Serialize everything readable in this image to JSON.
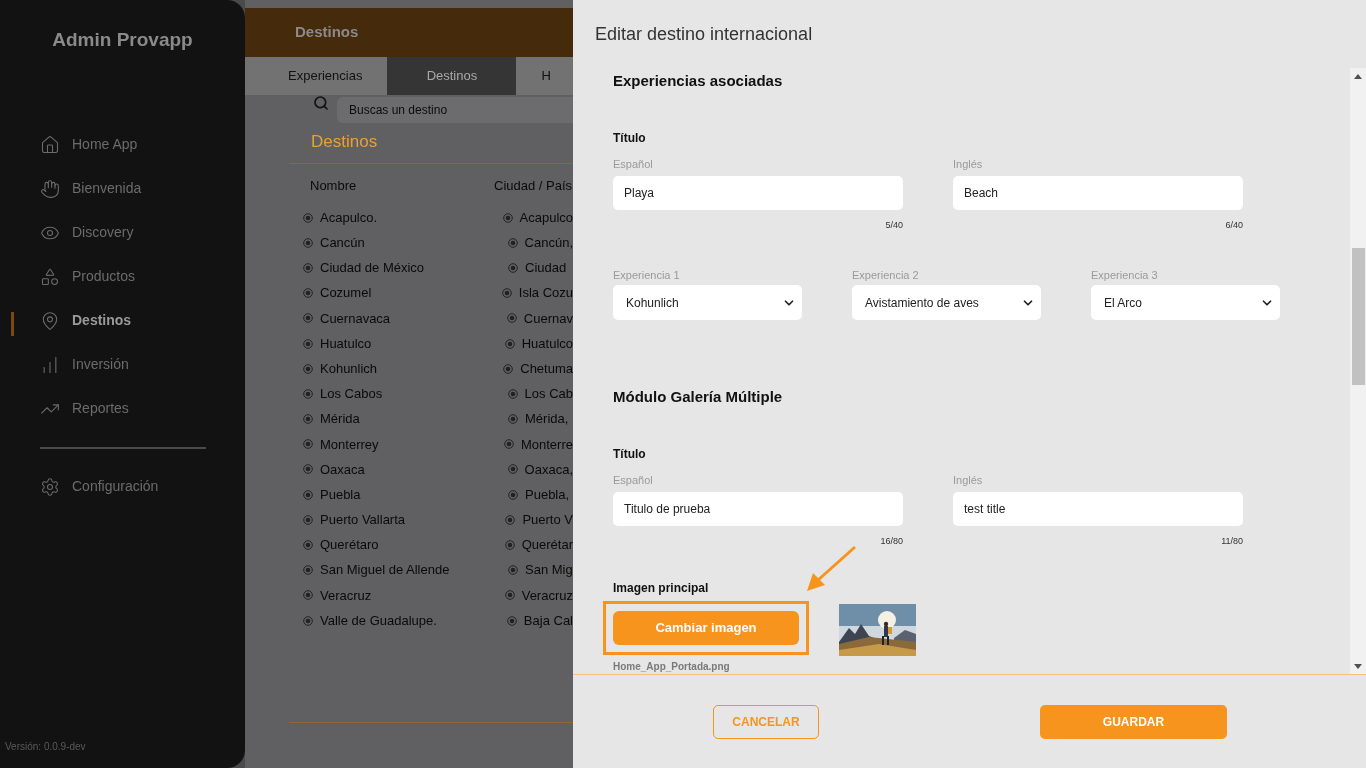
{
  "sidebar": {
    "title": "Admin Provapp",
    "items": [
      {
        "label": "Home App",
        "selected": false
      },
      {
        "label": "Bienvenida",
        "selected": false
      },
      {
        "label": "Discovery",
        "selected": false
      },
      {
        "label": "Productos",
        "selected": false
      },
      {
        "label": "Destinos",
        "selected": true
      },
      {
        "label": "Inversión",
        "selected": false
      },
      {
        "label": "Reportes",
        "selected": false
      }
    ],
    "footer_items": [
      {
        "label": "Configuración",
        "selected": false
      }
    ],
    "version": "Versión: 0.0.9-dev"
  },
  "page": {
    "header_title": "Destinos",
    "tabs": [
      {
        "label": "Experiencias",
        "selected": false
      },
      {
        "label": "Destinos",
        "selected": true
      },
      {
        "label": "H",
        "selected": false
      }
    ],
    "search": {
      "placeholder": "Buscas un destino"
    },
    "list_title": "Destinos",
    "table": {
      "columns": [
        "Nombre",
        "Ciudad / País"
      ],
      "rows": [
        [
          "Acapulco.",
          "Acapulco"
        ],
        [
          "Cancún",
          "Cancún,"
        ],
        [
          "Ciudad de México",
          "Ciudad"
        ],
        [
          "Cozumel",
          "Isla Cozu"
        ],
        [
          "Cuernavaca",
          "Cuernav"
        ],
        [
          "Huatulco",
          "Huatulco"
        ],
        [
          "Kohunlich",
          "Chetuma"
        ],
        [
          "Los Cabos",
          "Los Cab"
        ],
        [
          "Mérida",
          "Mérida,"
        ],
        [
          "Monterrey",
          "Monterre"
        ],
        [
          "Oaxaca",
          "Oaxaca,"
        ],
        [
          "Puebla",
          "Puebla,"
        ],
        [
          "Puerto Vallarta",
          "Puerto V"
        ],
        [
          "Querétaro",
          "Querétar"
        ],
        [
          "San Miguel de Allende",
          "San Mig"
        ],
        [
          "Veracruz",
          "Veracruz"
        ],
        [
          "Valle de Guadalupe.",
          "Baja Cal"
        ]
      ]
    }
  },
  "dialog": {
    "title": "Editar destino internacional",
    "experiences": {
      "title": "Experiencias asociadas",
      "subtitle": "Título",
      "fields": [
        {
          "label": "Español",
          "value": "Playa",
          "counter": "5/40"
        },
        {
          "label": "Inglés",
          "value": "Beach",
          "counter": "6/40"
        }
      ],
      "selects": [
        {
          "label": "Experiencia 1",
          "value": "Kohunlich"
        },
        {
          "label": "Experiencia 2",
          "value": "Avistamiento de aves"
        },
        {
          "label": "Experiencia 3",
          "value": "El Arco"
        }
      ]
    },
    "gallery": {
      "title": "Módulo Galería Múltiple",
      "subtitle": "Título",
      "fields": [
        {
          "label": "Español",
          "value": "Titulo de prueba",
          "counter": "16/80"
        },
        {
          "label": "Inglés",
          "value": "test title",
          "counter": "11/80"
        }
      ],
      "image": {
        "label": "Imagen principal",
        "button": "Cambiar imagen",
        "highlighted": true,
        "filename": "Home_App_Portada.png"
      }
    },
    "buttons": {
      "cancel": "CANCELAR",
      "save": "GUARDAR"
    }
  }
}
